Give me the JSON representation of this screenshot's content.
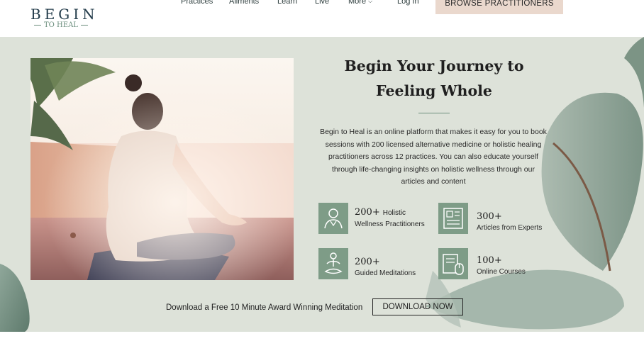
{
  "logo": {
    "main": "BEGIN",
    "sub": "TO HEAL"
  },
  "nav": {
    "items": [
      {
        "label": "Practices"
      },
      {
        "label": "Ailments"
      },
      {
        "label": "Learn"
      },
      {
        "label": "Live"
      },
      {
        "label": "More",
        "icon": "chevron-down-icon"
      },
      {
        "label": "Log In"
      }
    ],
    "cta": "BROWSE PRACTITIONERS"
  },
  "hero": {
    "heading_line1": "Begin Your Journey to",
    "heading_line2": "Feeling Whole",
    "description": "Begin to Heal is an online platform that makes it easy for you to book sessions with 200 licensed alternative medicine or holistic healing practitioners across 12 practices. You can also educate yourself through life-changing insights on holistic wellness through our articles and content",
    "image_subject": "woman meditating cross-legged by the sea",
    "stats": [
      {
        "number": "200+",
        "inline": "Holistic",
        "label": "Wellness Practitioners",
        "icon": "practitioner-icon"
      },
      {
        "number": "300+",
        "inline": "",
        "label": "Articles from Experts",
        "icon": "article-icon"
      },
      {
        "number": "200+",
        "inline": "",
        "label": "Guided Meditations",
        "icon": "meditation-icon"
      },
      {
        "number": "100+",
        "inline": "",
        "label": "Online Courses",
        "icon": "course-icon"
      }
    ],
    "download_text": "Download a Free 10 Minute Award  Winning Meditation",
    "download_button": "DOWNLOAD NOW"
  },
  "colors": {
    "hero_bg": "#dde2d9",
    "accent_green": "#7e9c87",
    "cta_bg": "#ead8cd",
    "heading_text": "#1f1f1f"
  }
}
